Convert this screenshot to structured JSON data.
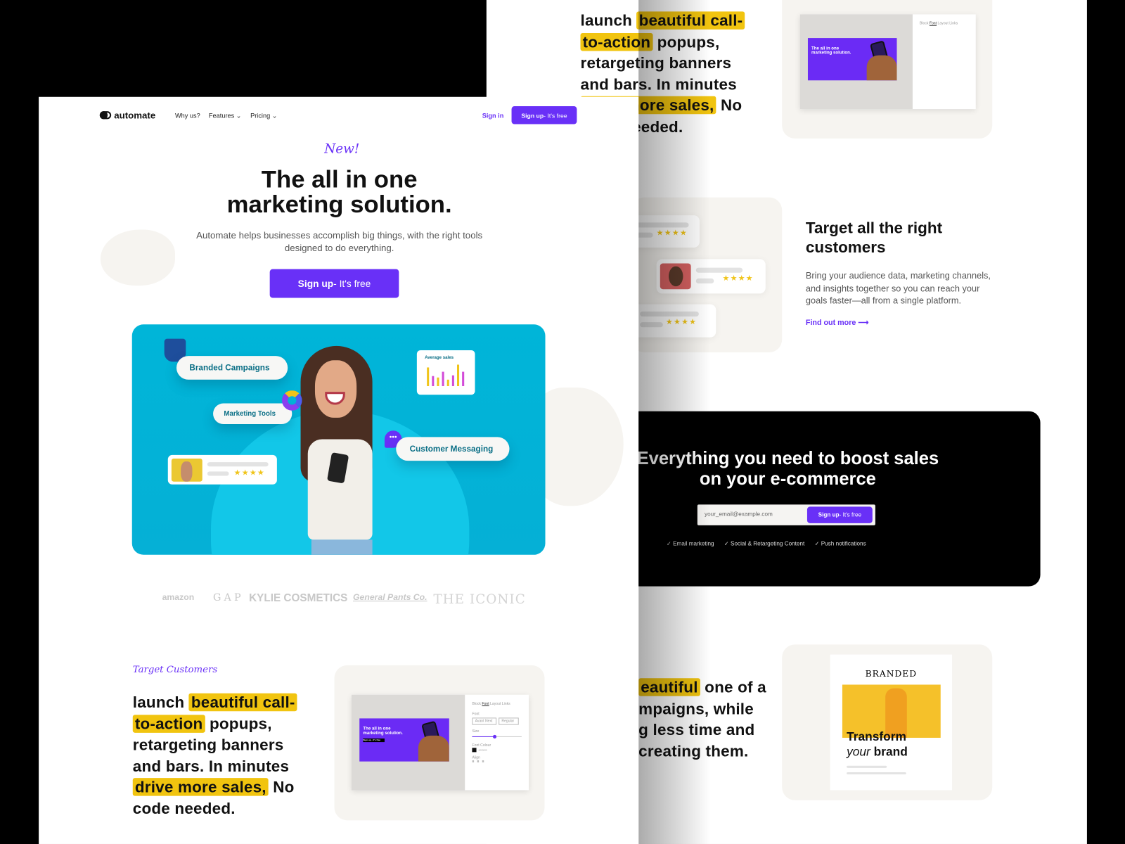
{
  "colors": {
    "accent": "#6930f7",
    "highlight": "#f1c40f",
    "hero_bg": "#00b5d8",
    "dark": "#000000"
  },
  "nav": {
    "logo": "automate",
    "items": [
      {
        "label": "Why us?"
      },
      {
        "label": "Features",
        "icon": "chevron-down-icon"
      },
      {
        "label": "Pricing",
        "icon": "chevron-down-icon"
      }
    ],
    "sign_in": "Sign in",
    "signup_bold": "Sign up",
    "signup_rest": " - It's free"
  },
  "hero": {
    "badge": "New!",
    "title_line1": "The all in one",
    "title_line2": "marketing solution.",
    "subtitle_line1": "Automate helps businesses accomplish big things, with the right tools",
    "subtitle_line2": "designed to do everything.",
    "cta_bold": "Sign up",
    "cta_rest": " - It's free",
    "image": {
      "pill_branded": "Branded Campaigns",
      "pill_tools": "Marketing Tools",
      "pill_messaging": "Customer Messaging",
      "chart_title": "Average sales",
      "rating_stars": "★★★★"
    }
  },
  "brands": [
    "amazon",
    "GAP",
    "KYLIE COSMETICS",
    "General Pants Co.",
    "THE ICONIC"
  ],
  "section_target": {
    "eyebrow": "Target Customers",
    "text": [
      [
        {
          "t": "launch ",
          "h": false
        },
        {
          "t": "beautiful call-",
          "h": true
        }
      ],
      [
        {
          "t": "to-action",
          "h": true
        },
        {
          "t": " popups,",
          "h": false
        }
      ],
      [
        {
          "t": "retargeting banners",
          "h": false
        }
      ],
      [
        {
          "t": "and bars. In minutes",
          "h": false
        }
      ],
      [
        {
          "t": "drive more sales,",
          "h": true
        },
        {
          "t": " No",
          "h": false
        }
      ],
      [
        {
          "t": "code needed.",
          "h": false
        }
      ]
    ],
    "editor": {
      "tabs": [
        "Block",
        "Font",
        "Layout",
        "Links"
      ],
      "active_tab": "Font",
      "font_label": "Font",
      "font_value": "Avant Next",
      "weight_value": "Regular",
      "size_label": "Size",
      "size_value": 0.45,
      "colour_label": "Font Colour",
      "colour_value": "#000000",
      "align_label": "Align",
      "banner_title_1": "The all in one",
      "banner_title_2": "marketing solution.",
      "banner_badge": "New!",
      "banner_button": "Sign up - It's free"
    }
  },
  "back_page": {
    "target": {
      "title_line1": "Target all the right",
      "title_line2": "customers",
      "body_line1": "Bring your audience data, marketing channels,",
      "body_line2": "and insights together so you can reach your",
      "body_line3": "goals faster—all from a single platform.",
      "link": "Find out more",
      "rating_stars": "★★★★"
    },
    "cta": {
      "title_line1": "Everything you need to boost sales",
      "title_line2": "on your e-commerce",
      "email_placeholder": "your_email@example.com",
      "button_bold": "Sign up",
      "button_rest": " - It's free",
      "features": [
        "Email marketing",
        "Social & Retargeting Content",
        "Push notifications"
      ]
    },
    "campaigns_text": [
      [
        {
          "t": "eautiful",
          "h": true
        },
        {
          "t": " one of a",
          "h": false
        }
      ],
      [
        {
          "t": "mpaigns, while",
          "h": false
        }
      ],
      [
        {
          "t": "g less time and",
          "h": false
        }
      ],
      [
        {
          "t": "creating them.",
          "h": false
        }
      ]
    ],
    "branded": {
      "brand": "BRANDED",
      "headline_1": "Transform",
      "headline_2_italic": "your",
      "headline_2_rest": " brand"
    }
  }
}
